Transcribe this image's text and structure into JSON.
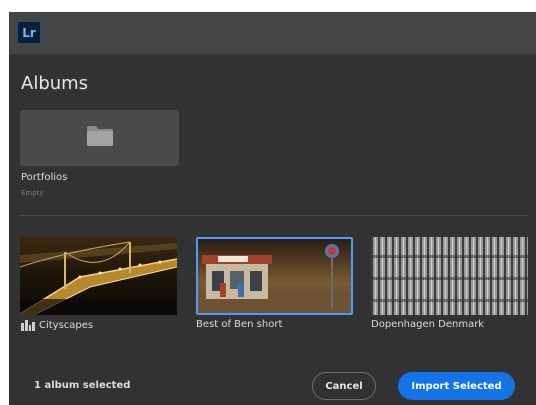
{
  "app": {
    "logo_text": "Lr"
  },
  "heading": "Albums",
  "album": {
    "name": "Portfolios",
    "subtitle": "Empty"
  },
  "collections": [
    {
      "label": "Cityscapes",
      "icon": "cityscape-icon",
      "selected": false
    },
    {
      "label": "Best of Ben short",
      "icon": "",
      "selected": true
    },
    {
      "label": "Dopenhagen Denmark",
      "icon": "",
      "selected": false
    }
  ],
  "footer": {
    "status": "1 album selected",
    "cancel_label": "Cancel",
    "import_label": "Import Selected"
  },
  "colors": {
    "accent": "#1473e6",
    "selection": "#4a9cff",
    "dialog_bg": "#323232",
    "titlebar_bg": "#454545"
  }
}
